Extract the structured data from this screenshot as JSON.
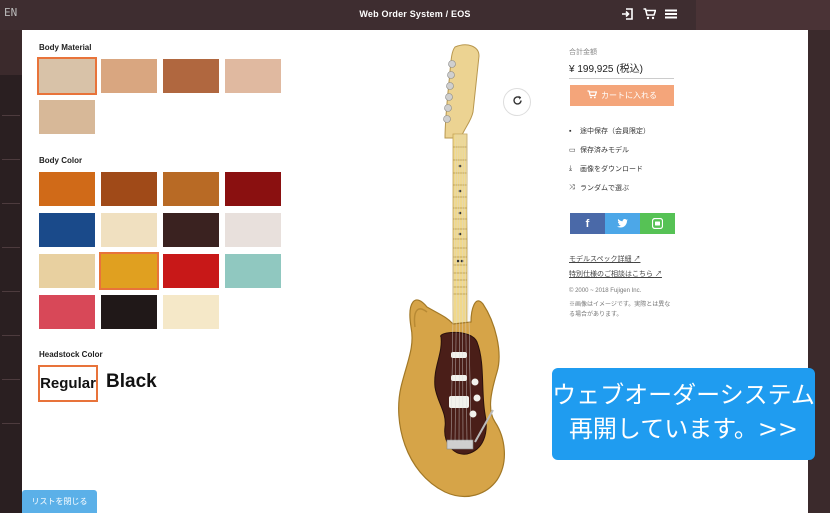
{
  "app": {
    "title": "Web Order System / EOS",
    "logo_text": "EN"
  },
  "header_icons": [
    "login-icon",
    "cart-icon",
    "menu-icon"
  ],
  "sections": {
    "body_material": {
      "title": "Body Material",
      "swatches": [
        {
          "color": "#d8c2a8",
          "selected": true
        },
        {
          "color": "#d9a680",
          "selected": false
        },
        {
          "color": "#b0673f",
          "selected": false
        },
        {
          "color": "#e0b9a0",
          "selected": false
        },
        {
          "color": "#d7b898",
          "selected": false
        }
      ]
    },
    "body_color": {
      "title": "Body Color",
      "swatches": [
        {
          "color": "#d06a18",
          "selected": false
        },
        {
          "color": "#a04a18",
          "selected": false
        },
        {
          "color": "#b86a25",
          "selected": false
        },
        {
          "color": "#8a1010",
          "selected": false
        },
        {
          "color": "#1a4a8a",
          "selected": false
        },
        {
          "color": "#f0e0c0",
          "selected": false
        },
        {
          "color": "#3a2220",
          "selected": false
        },
        {
          "color": "#e8e0dc",
          "selected": false
        },
        {
          "color": "#e8d0a0",
          "selected": false
        },
        {
          "color": "#e0a020",
          "selected": true
        },
        {
          "color": "#c81818",
          "selected": false
        },
        {
          "color": "#90c8c0",
          "selected": false
        },
        {
          "color": "#d84858",
          "selected": false
        },
        {
          "color": "#201818",
          "selected": false
        },
        {
          "color": "#f5e8c8",
          "selected": false
        }
      ]
    },
    "headstock_color": {
      "title": "Headstock Color",
      "options": [
        "Regular",
        "Black"
      ],
      "selected": "Regular"
    }
  },
  "list_close_label": "リストを閉じる",
  "summary": {
    "total_label": "合計金額",
    "price": "¥ 199,925 (税込)",
    "cart_button": "カートに入れる"
  },
  "menu": [
    {
      "icon": "save-icon",
      "label": "途中保存（会員限定）"
    },
    {
      "icon": "folder-icon",
      "label": "保存済みモデル"
    },
    {
      "icon": "download-icon",
      "label": "画像をダウンロード"
    },
    {
      "icon": "shuffle-icon",
      "label": "ランダムで選ぶ"
    }
  ],
  "share": {
    "facebook": "f",
    "twitter": "🐦",
    "line": "L"
  },
  "links": [
    "モデルスペック詳細",
    "特別仕様のご相談はこちら"
  ],
  "copyright": "© 2000 ~ 2018 Fujigen Inc.",
  "notice": "※画像はイメージです。実際とは異なる場合があります。",
  "banner": {
    "line1": "ウェブオーダーシステム",
    "line2": "再開しています。>>"
  },
  "colors": {
    "accent": "#e8733a",
    "cart": "#f4a57a",
    "banner": "#1f9cf0",
    "topbar": "#3e2d30"
  }
}
